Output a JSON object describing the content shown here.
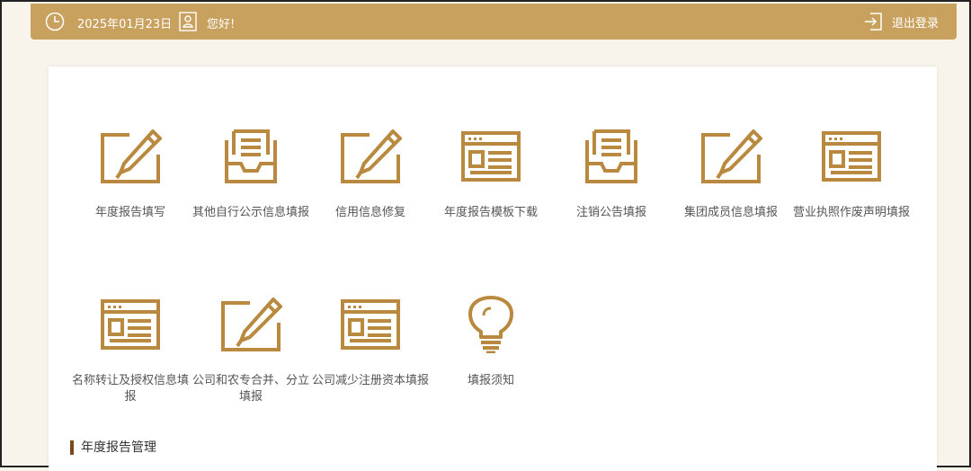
{
  "header": {
    "date": "2025年01月23日",
    "greeting": "您好!",
    "logout_label": "退出登录",
    "bar_color": "#c9a15f"
  },
  "tiles": [
    {
      "label": "年度报告填写",
      "icon": "edit-icon"
    },
    {
      "label": "其他自行公示信息填报",
      "icon": "inbox-document-icon"
    },
    {
      "label": "信用信息修复",
      "icon": "edit-icon"
    },
    {
      "label": "年度报告模板下载",
      "icon": "window-list-icon"
    },
    {
      "label": "注销公告填报",
      "icon": "inbox-document-icon"
    },
    {
      "label": "集团成员信息填报",
      "icon": "edit-icon"
    },
    {
      "label": "营业执照作废声明填报",
      "icon": "window-list-icon"
    },
    {
      "label": "名称转让及授权信息填报",
      "icon": "window-list-icon"
    },
    {
      "label": "公司和农专合并、分立填报",
      "icon": "edit-icon"
    },
    {
      "label": "公司减少注册资本填报",
      "icon": "window-list-icon"
    },
    {
      "label": "填报须知",
      "icon": "lightbulb-icon"
    }
  ],
  "section": {
    "title": "年度报告管理"
  },
  "colors": {
    "accent": "#b8893f",
    "section_bar": "#7a4a1c"
  }
}
